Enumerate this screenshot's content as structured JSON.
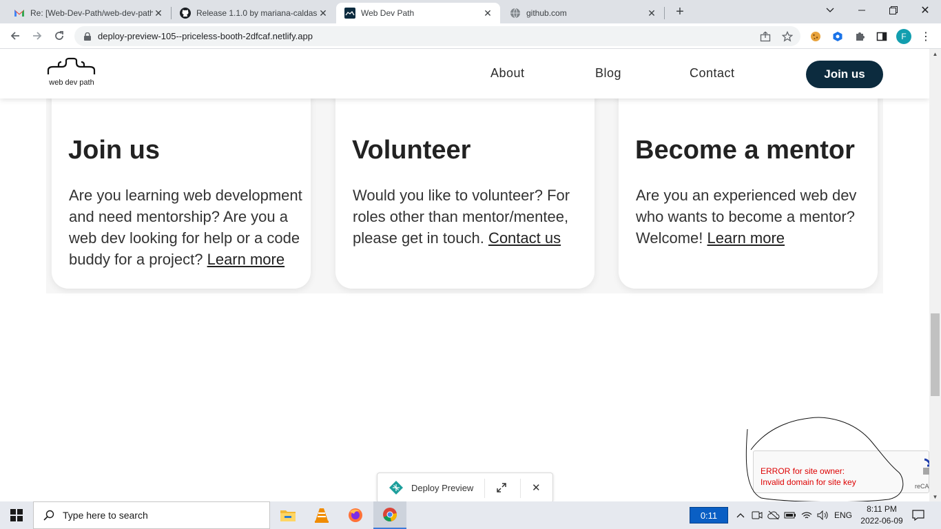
{
  "browser": {
    "tabs": [
      {
        "title": "Re: [Web-Dev-Path/web-dev-path",
        "icon": "gmail-icon"
      },
      {
        "title": "Release 1.1.0 by mariana-caldas",
        "icon": "github-icon"
      },
      {
        "title": "Web Dev Path",
        "icon": "webdevpath-icon"
      },
      {
        "title": "github.com",
        "icon": "globe-icon"
      }
    ],
    "active_tab": 2,
    "url": "deploy-preview-105--priceless-booth-2dfcaf.netlify.app",
    "profile_initial": "F"
  },
  "site": {
    "logo_text": "web dev path",
    "nav": {
      "about": "About",
      "blog": "Blog",
      "contact": "Contact",
      "join": "Join us"
    },
    "cards": [
      {
        "title": "Join us",
        "text": "Are you learning web development and need mentorship? Are you a web dev looking for help or a code buddy for a project?",
        "link": "Learn more"
      },
      {
        "title": "Volunteer",
        "text": "Would you like to volunteer? For roles other than mentor/mentee, please get in touch.",
        "link": "Contact us"
      },
      {
        "title": "Become a mentor",
        "text": "Are you an experienced web dev who wants to become a mentor? Welcome!",
        "link": "Learn more"
      }
    ],
    "deploy_preview": "Deploy Preview",
    "recaptcha": {
      "error_line1": "ERROR for site owner:",
      "error_line2": "Invalid domain for site key",
      "label": "reCA"
    }
  },
  "taskbar": {
    "search_placeholder": "Type here to search",
    "timer": "0:11",
    "language": "ENG",
    "time": "8:11 PM",
    "date": "2022-06-09"
  },
  "colors": {
    "brand_dark": "#0c2b3e",
    "error": "#dd0000",
    "accent_profile": "#129eaf"
  }
}
